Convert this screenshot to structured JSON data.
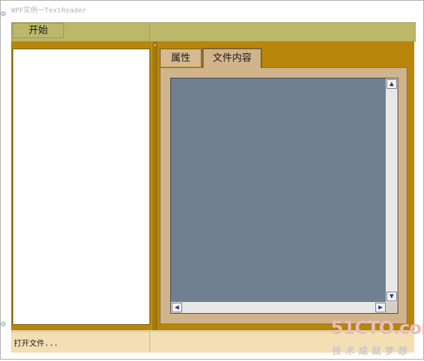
{
  "window": {
    "title": "WPF实例一TextReader"
  },
  "menu": {
    "items": [
      {
        "label": "开始"
      }
    ]
  },
  "tabs": [
    {
      "label": "属性",
      "selected": false
    },
    {
      "label": "文件内容",
      "selected": true
    }
  ],
  "scrollbars": {
    "up_arrow": "▲",
    "down_arrow": "▼",
    "left_arrow": "◀",
    "right_arrow": "▶"
  },
  "grips": {
    "top": "❂",
    "bottom": "❂"
  },
  "status": {
    "text": "打开文件..."
  },
  "watermark": {
    "logo": "51CTO.com",
    "subtitle": "技术成就梦想"
  },
  "colors": {
    "menu_bar": "#bcb86a",
    "content_background": "#b8860b",
    "tab_panel": "#d2b48c",
    "text_area": "#708090",
    "status_bar": "#f4deb3"
  }
}
